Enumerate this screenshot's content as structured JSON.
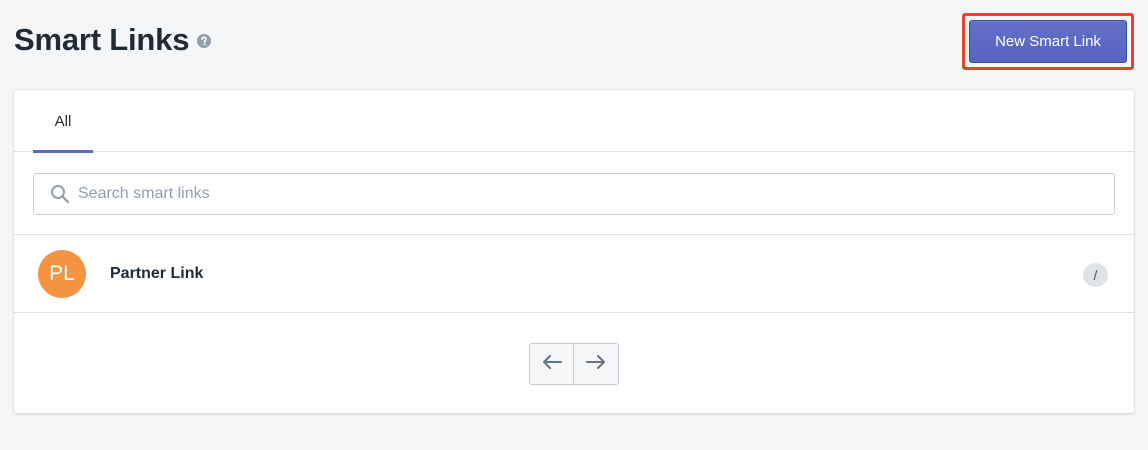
{
  "header": {
    "title": "Smart Links",
    "help_icon": "question-circle-icon",
    "new_button_label": "New Smart Link"
  },
  "tabs": [
    {
      "label": "All",
      "selected": true
    }
  ],
  "search": {
    "placeholder": "Search smart links",
    "value": "",
    "icon": "search-icon"
  },
  "links": [
    {
      "initials": "PL",
      "name": "Partner Link",
      "badge": "/"
    }
  ],
  "pagination": {
    "prev_icon": "arrow-left-icon",
    "next_icon": "arrow-right-icon"
  },
  "colors": {
    "accent": "#5c6ac4",
    "highlight": "#e8402a",
    "avatar": "#f49342",
    "background": "#f4f6f8"
  }
}
